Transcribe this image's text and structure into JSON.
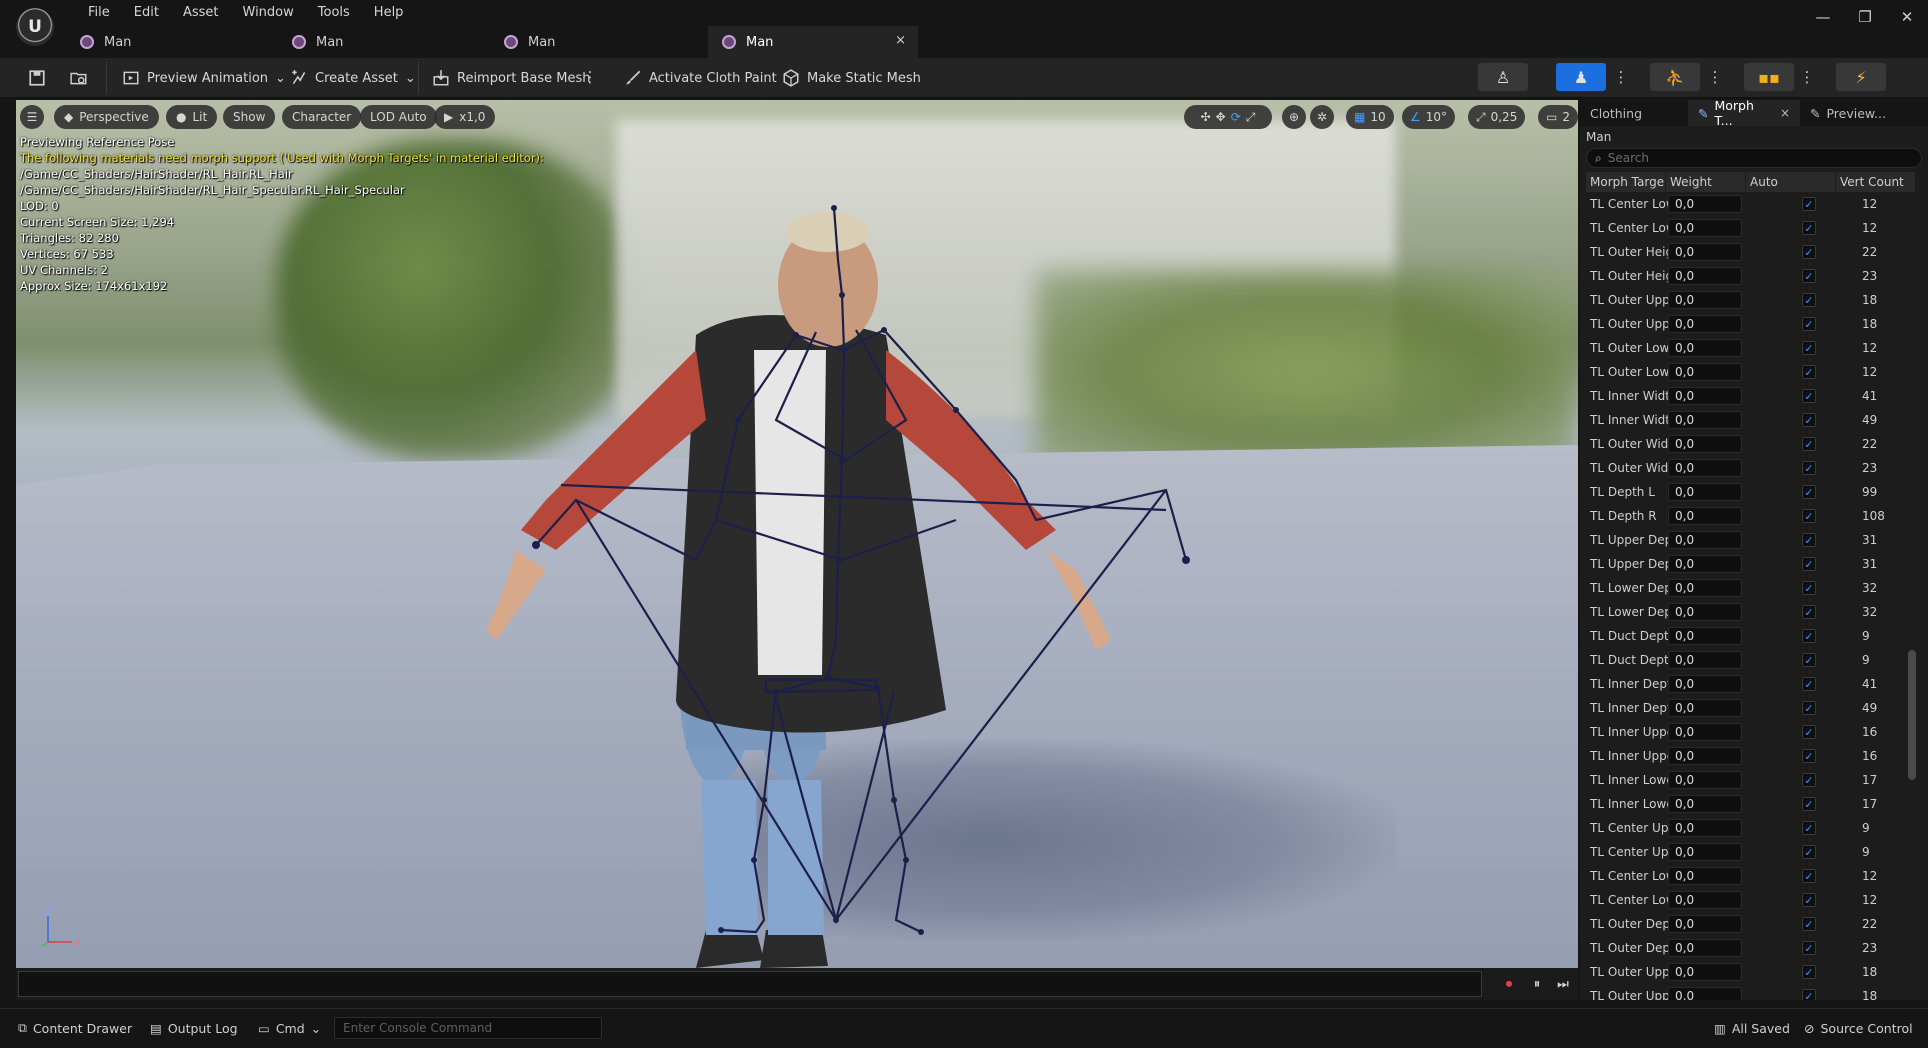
{
  "app": {
    "logo_text": "U"
  },
  "menu": [
    "File",
    "Edit",
    "Asset",
    "Window",
    "Tools",
    "Help"
  ],
  "window_controls": {
    "minimize": "—",
    "restore": "❐",
    "close": "✕"
  },
  "tabs": [
    {
      "label": "Man",
      "active": false
    },
    {
      "label": "Man",
      "active": false
    },
    {
      "label": "Man",
      "active": false
    },
    {
      "label": "Man",
      "active": true,
      "close": "×"
    }
  ],
  "toolbar": {
    "preview_animation": "Preview Animation",
    "create_asset": "Create Asset",
    "reimport": "Reimport Base Mesh",
    "cloth_paint": "Activate Cloth Paint",
    "static_mesh": "Make Static Mesh"
  },
  "viewport": {
    "perspective": "Perspective",
    "lit": "Lit",
    "show": "Show",
    "character": "Character",
    "lod": "LOD Auto",
    "speed": "x1,0",
    "grid_snap": "10",
    "angle_snap": "10°",
    "scale_snap": "0,25",
    "camera_speed": "2",
    "info": {
      "line1": "Previewing Reference Pose",
      "warning": "The following materials need morph support ('Used with Morph Targets' in material editor):",
      "mat1": "/Game/CC_Shaders/HairShader/RL_Hair.RL_Hair",
      "mat2": "/Game/CC_Shaders/HairShader/RL_Hair_Specular.RL_Hair_Specular",
      "lod": "LOD: 0",
      "screen_size": "Current Screen Size: 1,294",
      "triangles": "Triangles: 82 280",
      "vertices": "Vertices: 67 533",
      "uv": "UV Channels: 2",
      "approx": "Approx Size: 174x61x192"
    },
    "axis": {
      "z": "Z",
      "x": "X"
    }
  },
  "right_panel": {
    "tabs": [
      {
        "label": "Clothing",
        "active": false
      },
      {
        "label": "Morph T...",
        "active": true,
        "close": "×"
      },
      {
        "label": "Preview...",
        "active": false
      }
    ],
    "mesh_name": "Man",
    "search_placeholder": "Search",
    "columns": {
      "name": "Morph Targe",
      "weight": "Weight",
      "auto": "Auto",
      "vert": "Vert Count"
    },
    "rows": [
      {
        "name": "TL Center Low",
        "weight": "0,0",
        "vert": "12"
      },
      {
        "name": "TL Center Low",
        "weight": "0,0",
        "vert": "12"
      },
      {
        "name": "TL Outer Heig",
        "weight": "0,0",
        "vert": "22"
      },
      {
        "name": "TL Outer Heig",
        "weight": "0,0",
        "vert": "23"
      },
      {
        "name": "TL Outer Uppe",
        "weight": "0,0",
        "vert": "18"
      },
      {
        "name": "TL Outer Uppe",
        "weight": "0,0",
        "vert": "18"
      },
      {
        "name": "TL Outer Lowe",
        "weight": "0,0",
        "vert": "12"
      },
      {
        "name": "TL Outer Lowe",
        "weight": "0,0",
        "vert": "12"
      },
      {
        "name": "TL Inner Width",
        "weight": "0,0",
        "vert": "41"
      },
      {
        "name": "TL Inner Width",
        "weight": "0,0",
        "vert": "49"
      },
      {
        "name": "TL Outer Width",
        "weight": "0,0",
        "vert": "22"
      },
      {
        "name": "TL Outer Width",
        "weight": "0,0",
        "vert": "23"
      },
      {
        "name": "TL Depth L",
        "weight": "0,0",
        "vert": "99"
      },
      {
        "name": "TL Depth R",
        "weight": "0,0",
        "vert": "108"
      },
      {
        "name": "TL Upper Dep",
        "weight": "0,0",
        "vert": "31"
      },
      {
        "name": "TL Upper Dep",
        "weight": "0,0",
        "vert": "31"
      },
      {
        "name": "TL Lower Dep",
        "weight": "0,0",
        "vert": "32"
      },
      {
        "name": "TL Lower Dep",
        "weight": "0,0",
        "vert": "32"
      },
      {
        "name": "TL Duct Depth",
        "weight": "0,0",
        "vert": "9"
      },
      {
        "name": "TL Duct Depth",
        "weight": "0,0",
        "vert": "9"
      },
      {
        "name": "TL Inner Deptl",
        "weight": "0,0",
        "vert": "41"
      },
      {
        "name": "TL Inner Deptl",
        "weight": "0,0",
        "vert": "49"
      },
      {
        "name": "TL Inner Uppe",
        "weight": "0,0",
        "vert": "16"
      },
      {
        "name": "TL Inner Uppe",
        "weight": "0,0",
        "vert": "16"
      },
      {
        "name": "TL Inner Lowe",
        "weight": "0,0",
        "vert": "17"
      },
      {
        "name": "TL Inner Lowe",
        "weight": "0,0",
        "vert": "17"
      },
      {
        "name": "TL Center Upp",
        "weight": "0,0",
        "vert": "9"
      },
      {
        "name": "TL Center Upp",
        "weight": "0,0",
        "vert": "9"
      },
      {
        "name": "TL Center Low",
        "weight": "0,0",
        "vert": "12"
      },
      {
        "name": "TL Center Low",
        "weight": "0,0",
        "vert": "12"
      },
      {
        "name": "TL Outer Dept",
        "weight": "0,0",
        "vert": "22"
      },
      {
        "name": "TL Outer Dept",
        "weight": "0,0",
        "vert": "23"
      },
      {
        "name": "TL Outer Uppe",
        "weight": "0,0",
        "vert": "18"
      },
      {
        "name": "TL Outer Uppe",
        "weight": "0,0",
        "vert": "18"
      }
    ]
  },
  "status": {
    "content_drawer": "Content Drawer",
    "output_log": "Output Log",
    "cmd": "Cmd",
    "console_placeholder": "Enter Console Command",
    "all_saved": "All Saved",
    "source_control": "Source Control"
  },
  "colors": {
    "accent": "#1b6fe0",
    "warning_text": "#f1e23c",
    "bone": "#1c1f4a"
  }
}
